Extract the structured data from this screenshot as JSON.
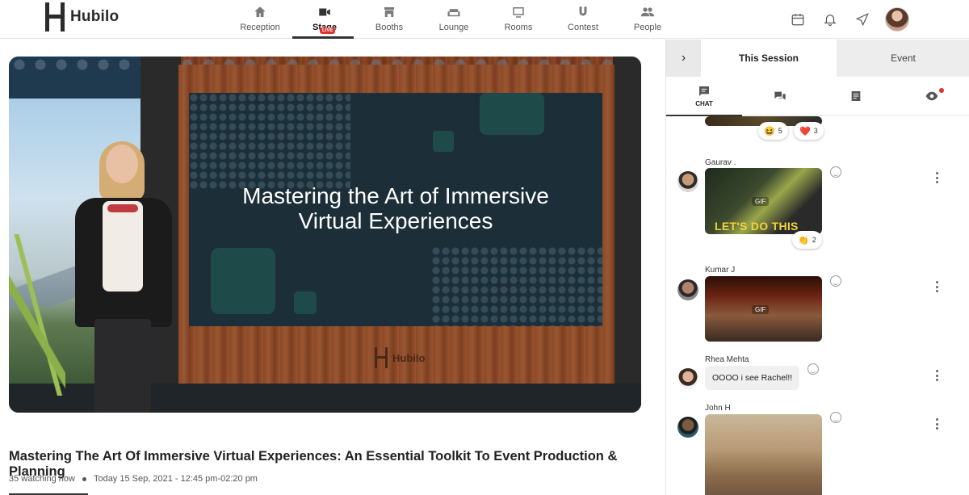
{
  "brand": {
    "name": "Hubilo"
  },
  "nav": {
    "items": [
      {
        "label": "Reception",
        "icon": "home-icon"
      },
      {
        "label": "Stage",
        "icon": "video-camera-icon",
        "badge": "LIVE"
      },
      {
        "label": "Booths",
        "icon": "booth-icon"
      },
      {
        "label": "Lounge",
        "icon": "sofa-icon"
      },
      {
        "label": "Rooms",
        "icon": "screen-icon"
      },
      {
        "label": "Contest",
        "icon": "magnet-icon"
      },
      {
        "label": "People",
        "icon": "people-icon"
      }
    ],
    "active": "Stage"
  },
  "top_icons": [
    "calendar-icon",
    "bell-icon",
    "send-icon",
    "user-avatar"
  ],
  "stage": {
    "slide_title_line1": "Mastering the Art of Immersive",
    "slide_title_line2": "Virtual Experiences",
    "backdrop_logo": "Hubilo",
    "session_title": "Mastering The Art Of Immersive Virtual Experiences: An Essential Toolkit To Event Production & Planning",
    "watching": "35 watching now",
    "schedule": "Today 15 Sep, 2021 - 12:45 pm-02:20 pm"
  },
  "sidebar": {
    "collapse_icon": "chevron-right-icon",
    "tabs": {
      "session": "This Session",
      "event": "Event"
    },
    "icon_tabs": [
      {
        "name": "chat",
        "label": "CHAT",
        "icon": "chat-icon"
      },
      {
        "name": "qna",
        "icon": "q-and-a-icon"
      },
      {
        "name": "notes",
        "icon": "notes-icon"
      },
      {
        "name": "viewers",
        "icon": "eye-icon"
      }
    ]
  },
  "chat": {
    "top_reactions": [
      {
        "emoji": "😆",
        "count": "5"
      },
      {
        "emoji": "❤️",
        "count": "3"
      }
    ],
    "messages": [
      {
        "user": "Gaurav .",
        "type": "gif",
        "gif_tag": "GIF",
        "gif_caption": "LET'S DO THIS",
        "reaction_emoji": "👏",
        "reaction_count": "2"
      },
      {
        "user": "Kumar J",
        "type": "gif",
        "gif_tag": "GIF"
      },
      {
        "user": "Rhea Mehta",
        "type": "text",
        "text": "OOOO i see Rachel!!"
      },
      {
        "user": "John H",
        "type": "gif"
      }
    ]
  },
  "colors": {
    "live_red": "#e0322f",
    "accent_dark": "#333333"
  }
}
